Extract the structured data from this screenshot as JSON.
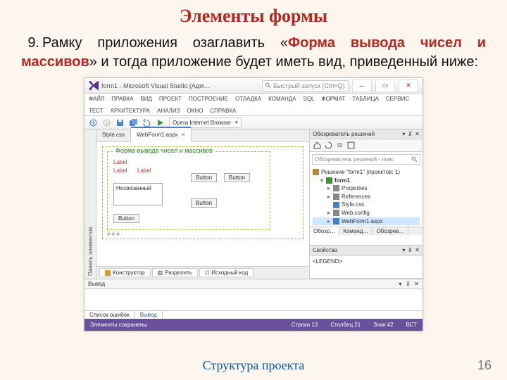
{
  "slide": {
    "title": "Элементы формы",
    "list_number": "9.",
    "text_before": "Рамку приложения озаглавить «",
    "highlight": "Форма вывода чисел и массивов",
    "text_after": "» и тогда приложение будет иметь вид, приведенный ниже:",
    "footer": "Структура проекта",
    "page": "16"
  },
  "vs": {
    "window_title": "form1 - Microsoft Visual Studio (Адм…",
    "quick_launch": "Быстрый запуск (Ctrl+Q)",
    "menu": [
      "ФАЙЛ",
      "ПРАВКА",
      "ВИД",
      "ПРОЕКТ",
      "ПОСТРОЕНИЕ",
      "ОТЛАДКА",
      "КОМАНДА",
      "SQL",
      "ФОРМАТ",
      "ТАБЛИЦА",
      "СЕРВИС",
      "ТЕСТ",
      "АРХИТЕКТУРА",
      "АНАЛИЗ",
      "ОКНО",
      "СПРАВКА"
    ],
    "browser_select": "Opera Internet Browser",
    "palette_title": "Панель элементов",
    "tabs": {
      "inactive": "Style.css",
      "active": "WebForm1.aspx"
    },
    "form": {
      "legend": "Форма вывода чисел и массивов",
      "label1": "Label",
      "label2": "Label",
      "label3": "Label",
      "btn1": "Button",
      "btn2": "Button",
      "btn3": "Button",
      "btn4": "Button",
      "textbox": "Несвязанный"
    },
    "hashes": "# # #",
    "view_tabs": {
      "design": "Конструктор",
      "split": "Разделить",
      "source": "Исходный код"
    },
    "solution": {
      "header": "Обозреватель решений",
      "search_ph": "Обозреватель решений - поис",
      "root": "Решение \"form1\" (проектов: 1)",
      "project": "form1",
      "nodes": [
        "Properties",
        "References",
        "Style.css",
        "Web.config",
        "WebForm1.aspx"
      ]
    },
    "right_tabs": [
      "Обозр…",
      "Команд…",
      "Обозрев…"
    ],
    "props": {
      "header": "Свойства",
      "value": "<LEGEND>"
    },
    "output": {
      "header": "Вывод",
      "tabs": [
        "Список ошибок",
        "Вывод"
      ]
    },
    "status": {
      "msg": "Элементы сохранены",
      "line": "Строка 13",
      "col": "Столбец 21",
      "ch": "Знак 42",
      "ins": "ВСТ"
    }
  }
}
